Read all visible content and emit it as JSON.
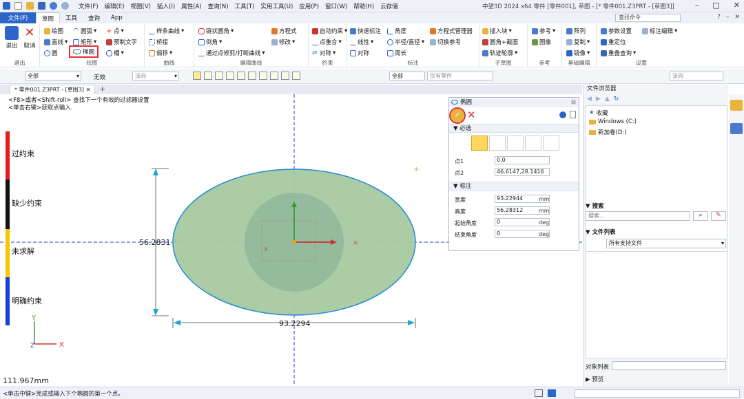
{
  "titlebar": {
    "menu": [
      "文件(F)",
      "编辑(E)",
      "视图(V)",
      "插入(I)",
      "属性(A)",
      "查询(N)",
      "工具(T)",
      "实用工具(U)",
      "应用(P)",
      "窗口(W)",
      "帮助(H)",
      "云存储"
    ],
    "window_title": "中望3D 2024 x64      零件 [零件001], 草图 - [* 零件001.Z3PRT - [草图3]]"
  },
  "tabs": {
    "file": "文件(F)",
    "items": [
      "草图",
      "工具",
      "查询",
      "App"
    ],
    "active": "草图",
    "search_placeholder": "查找命令"
  },
  "ribbon": {
    "exit": "退出",
    "cancel": "取消",
    "exit_group": "退出",
    "draw": {
      "line": "绘图",
      "line2": "直线",
      "circle": "圆",
      "arc": "圆弧",
      "rect": "矩形",
      "ellipse": "椭圆",
      "point": "点",
      "predef_text": "预制文字",
      "slot": "槽",
      "group": "绘图"
    },
    "curve": {
      "spline": "样条曲线",
      "bridge": "桥接",
      "offset": "偏移",
      "group": "曲线"
    },
    "edit": {
      "chain_fillet": "链状圆角",
      "chamfer": "倒角",
      "trim": "通过点修剪/打断曲线",
      "equation": "方程式",
      "modify": "修改",
      "group": "编辑曲线"
    },
    "constraint": {
      "auto": "自动约束",
      "point_on": "点重合",
      "symmetry": "对称",
      "group": "约束"
    },
    "dim": {
      "quick": "快速标注",
      "linear": "线性",
      "symmetric": "对称",
      "angle": "角度",
      "radius": "半径/直径",
      "perimeter": "周长",
      "eq_manager": "方程式管理器",
      "toggle_ref": "切换参考",
      "group": "标注"
    },
    "subsketch": {
      "insert": "插入块",
      "circle_section": "圆角+截面",
      "trace": "轨迹轮廓",
      "group": "子草图"
    },
    "ref": {
      "ref": "参考",
      "image": "图像",
      "group": "参考"
    },
    "basic_edit": {
      "array": "阵列",
      "copy": "复制",
      "mirror": "镜像",
      "group": "基础编辑"
    },
    "settings": {
      "param": "参数设置",
      "dim_edit": "标注编辑",
      "relocate": "重定位",
      "reeval": "重叠查询",
      "group": "设置"
    }
  },
  "filterbar": {
    "all": "全部",
    "invalid": "无效",
    "normal": "法向",
    "all_parts": "仅有零件",
    "all2": "全部",
    "normal2": "法向"
  },
  "doctab": {
    "label": "* 零件001.Z3PRT - [草图3]"
  },
  "canvas": {
    "hint1": "<F8>或者<Shift-roll> 查找下一个有效的过滤器设置",
    "hint2": "<单击右键>获取点输入.",
    "legend": [
      "过约束",
      "缺少约束",
      "未求解",
      "明确约束"
    ],
    "legend_colors": [
      "#e41c1c",
      "#111111",
      "#f5c800",
      "#1a3fd8"
    ],
    "dim_height": "56.2831",
    "dim_width": "93.2294",
    "coord": "111.967mm"
  },
  "dialog": {
    "title": "椭圆",
    "required": "必选",
    "point1_label": "点1",
    "point1_value": "0,0",
    "point2_label": "点2",
    "point2_value": "46.6147,28.1416",
    "dims_section": "标注",
    "width_label": "宽度",
    "width_value": "93.22944",
    "width_unit": "mm",
    "height_label": "高度",
    "height_value": "56.28312",
    "height_unit": "mm",
    "start_label": "起始角度",
    "start_value": "0",
    "start_unit": "deg",
    "end_label": "结束角度",
    "end_value": "0",
    "end_unit": "deg"
  },
  "right_panel": {
    "title": "文件浏览器",
    "tree": [
      {
        "label": "收藏"
      },
      {
        "label": "Windows (C:)"
      },
      {
        "label": "新加卷(D:)"
      }
    ],
    "search_section": "搜索",
    "search_placeholder": "搜索...",
    "file_list": "文件列表",
    "file_filter": "所有支持文件",
    "object_list": "对象列表",
    "preview": "预览"
  },
  "status": {
    "text": "<单击中键>完成或输入下个椭圆的第一个点。"
  }
}
